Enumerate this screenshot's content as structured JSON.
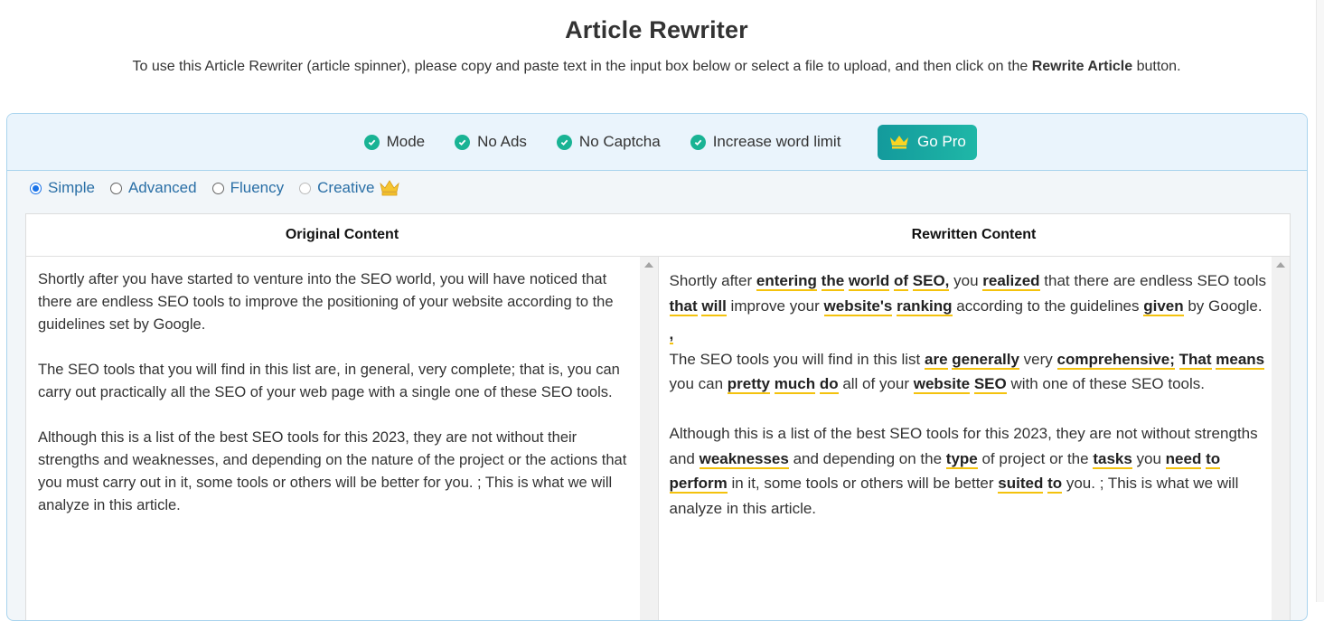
{
  "header": {
    "title": "Article Rewriter",
    "subtitle_pre": "To use this Article Rewriter (article spinner), please copy and paste text in the input box below or select a file to upload, and then click on the",
    "subtitle_bold": "Rewrite Article",
    "subtitle_post": "button."
  },
  "promo": {
    "features": [
      "Mode",
      "No Ads",
      "No Captcha",
      "Increase word limit"
    ],
    "go_pro_label": "Go Pro",
    "check_color": "#19b394",
    "gopro_color": "#17a6a1"
  },
  "modes": {
    "options": [
      "Simple",
      "Advanced",
      "Fluency",
      "Creative"
    ],
    "selected": "Simple",
    "creative_icon": "crown-icon"
  },
  "original": {
    "header": "Original Content",
    "paragraphs": [
      "Shortly after you have started to venture into the SEO world, you will have noticed that there are endless SEO tools to improve the positioning of your website according to the guidelines set by Google.",
      "The SEO tools that you will find in this list are, in general, very complete; that is, you can carry out practically all the SEO of your web page with a single one of these SEO tools.",
      "Although this is a list of the best SEO tools for this 2023, they are not without their strengths and weaknesses, and depending on the nature of the project or the actions that you must carry out in it, some tools or others will be better for you. ; This is what we will analyze in this article."
    ]
  },
  "rewritten": {
    "header": "Rewritten Content",
    "p1": {
      "t0": "Shortly after ",
      "h1": "entering",
      "h2": "the",
      "h3": "world",
      "t1": " ",
      "h4": "of",
      "h5": "SEO,",
      "t2": " you ",
      "h6": "realized",
      "t3": " that there are endless SEO tools ",
      "h7": "that",
      "h8": "will",
      "t4": " improve  your ",
      "h9": "website's",
      "h10": "ranking",
      "t5": " according to the guidelines ",
      "h11": "given",
      "t6": " by Google."
    },
    "p2": {
      "comma": ",",
      "t0": " The SEO tools  you will find in this list ",
      "h1": "are",
      "h2": "generally",
      "t1": " very ",
      "h3": "comprehensive;",
      "h4": "That",
      "h5": "means",
      "t2": " you can ",
      "h6": "pretty",
      "h7": "much",
      "h8": "do",
      "t3": " all  of your ",
      "h9": "website",
      "h10": "SEO",
      "t4": " with  one of these SEO tools."
    },
    "p3": {
      "t0": " Although this is a list of the best SEO tools for this 2023, they are not without strengths and ",
      "h1": "weaknesses",
      "t1": " and depending on the ",
      "h2": "type",
      "t2": " of  project or the ",
      "h3": "tasks",
      "t3": " you ",
      "h4": "need",
      "h5": "to",
      "h6": "perform",
      "t4": " in it, some tools or others will be better ",
      "h7": "suited",
      "h8": "to",
      "t5": " you. ; This is what we will analyze in this article."
    },
    "highlight_color": "#f4c20d"
  }
}
